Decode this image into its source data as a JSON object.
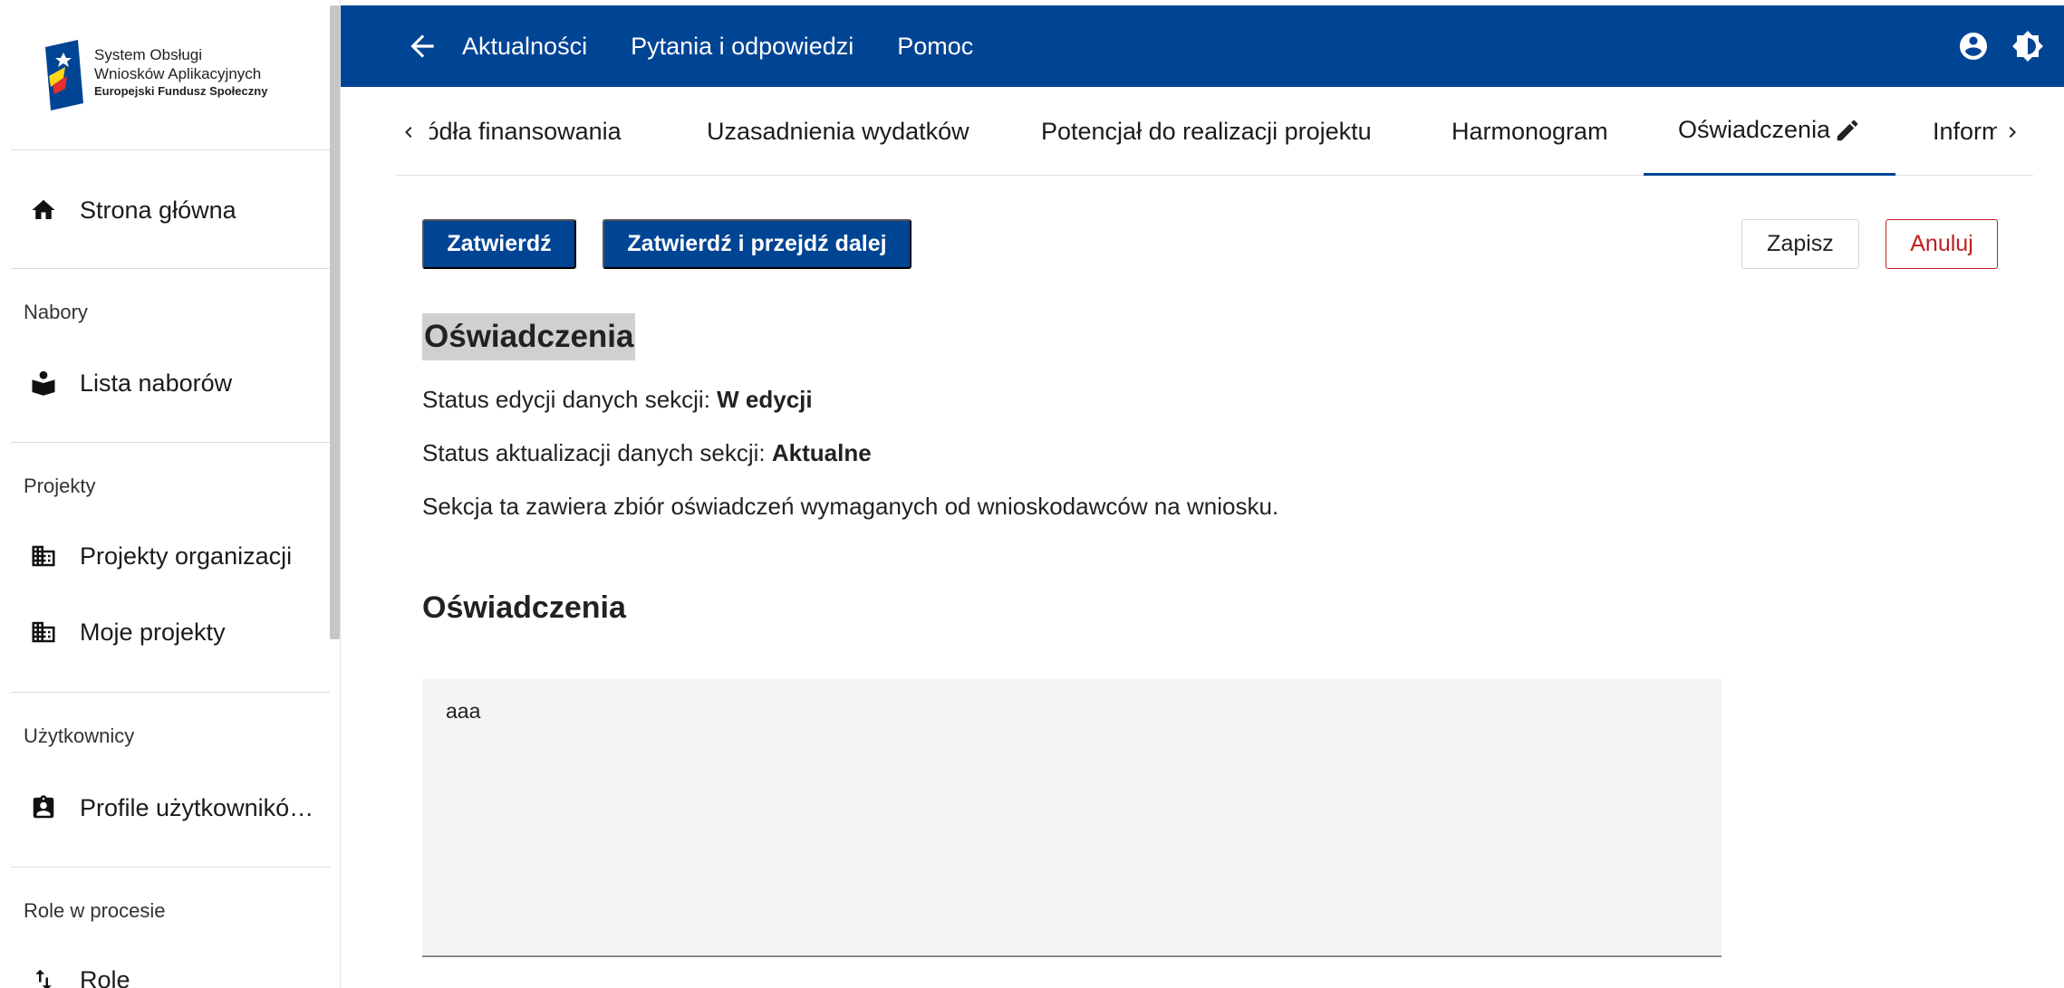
{
  "sidebar": {
    "logo": {
      "line1": "System Obsługi",
      "line2": "Wniosków Aplikacyjnych",
      "line3": "Europejski Fundusz Społeczny"
    },
    "home_label": "Strona główna",
    "groups": {
      "nabory": "Nabory",
      "projekty": "Projekty",
      "uzytkownicy": "Użytkownicy",
      "role": "Role w procesie"
    },
    "items": {
      "lista_naborow": "Lista naborów",
      "projekty_organizacji": "Projekty organizacji",
      "moje_projekty": "Moje projekty",
      "profile_uzytkownikow": "Profile użytkownikó…",
      "role": "Role"
    }
  },
  "topbar": {
    "nav": [
      "Aktualności",
      "Pytania i odpowiedzi",
      "Pomoc"
    ],
    "icons": [
      "arrow-back-icon",
      "account-circle-icon",
      "brightness-icon"
    ]
  },
  "tabs": {
    "items": [
      "Źródła finansowania",
      "Uzasadnienia wydatków",
      "Potencjał do realizacji projektu",
      "Harmonogram",
      "Oświadczenia",
      "Informacje"
    ],
    "active_index": 4
  },
  "actions": {
    "confirm": "Zatwierdź",
    "confirm_next": "Zatwierdź i przejdź dalej",
    "save": "Zapisz",
    "cancel": "Anuluj"
  },
  "content": {
    "section_title": "Oświadczenia",
    "edit_status_label": "Status edycji danych sekcji: ",
    "edit_status_value": "W edycji",
    "update_status_label": "Status aktualizacji danych sekcji: ",
    "update_status_value": "Aktualne",
    "description": "Sekcja ta zawiera zbiór oświadczeń wymaganych od wnioskodawców na wniosku.",
    "subsection_title": "Oświadczenia",
    "textarea_value": "aaa"
  },
  "colors": {
    "primary": "#004494",
    "danger": "#c11e1e",
    "highlight": "#d0d0d0"
  }
}
